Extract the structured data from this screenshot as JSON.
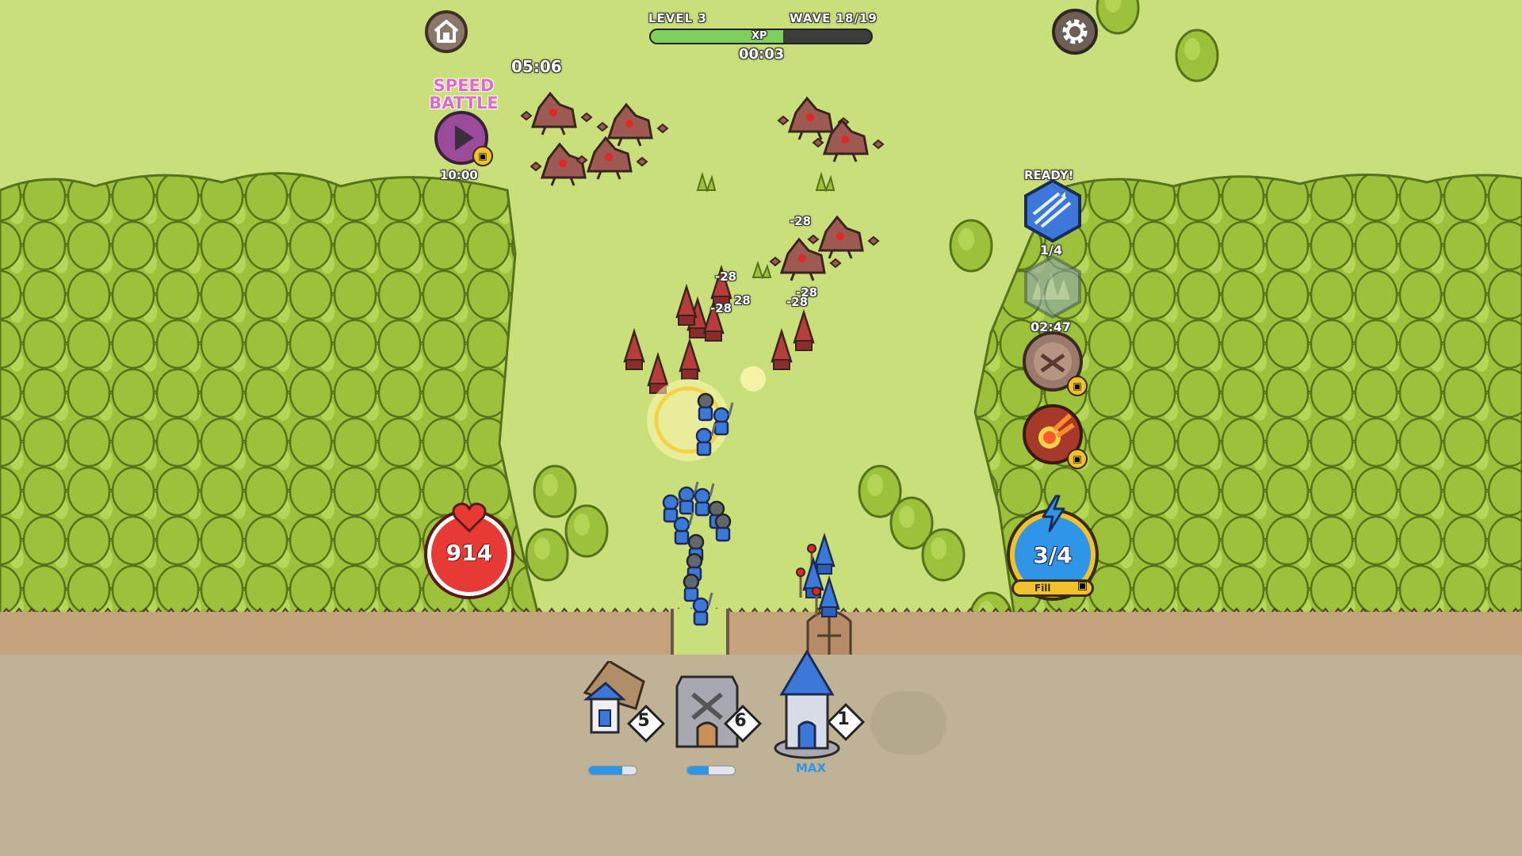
{
  "top_bar": {
    "level_label": "LEVEL 3",
    "wave_label": "WAVE 18/19",
    "xp_label": "XP",
    "xp_progress": 0.6,
    "wave_timer": "00:03",
    "battle_timer": "05:06"
  },
  "speed_battle": {
    "title_line1": "SPEED",
    "title_line2": "BATTLE",
    "timer": "10:00"
  },
  "abilities": {
    "ready_label": "READY!",
    "arrows_charges": "1/4",
    "cooldown_timer": "02:47"
  },
  "health": {
    "value": "914"
  },
  "energy": {
    "value": "3/4",
    "fill_label": "Fill"
  },
  "damage_numbers": [
    "-28",
    "-28",
    "-28",
    "28",
    "-28",
    "-28",
    "-28"
  ],
  "buildings": [
    {
      "name": "archer-house",
      "level": "5",
      "progress": 0.7,
      "max_label": ""
    },
    {
      "name": "barracks",
      "level": "6",
      "progress": 0.45,
      "max_label": ""
    },
    {
      "name": "mage-tower",
      "level": "1",
      "progress": 1.0,
      "max_label": "MAX"
    }
  ],
  "colors": {
    "accent_blue": "#2f95e6",
    "health_red": "#e83a34",
    "speed_battle_pink": "#e06ac8",
    "field_green": "#c9df7a"
  },
  "icons": [
    "home-icon",
    "gear-icon",
    "play-icon",
    "heart-icon",
    "lightning-icon",
    "video-ad-icon"
  ]
}
